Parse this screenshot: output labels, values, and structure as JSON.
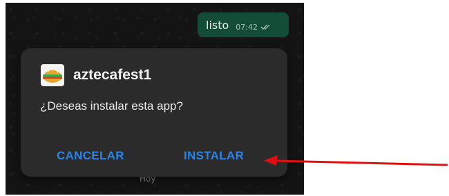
{
  "chat": {
    "message_text": "listo",
    "message_time": "07:42",
    "date_label": "Hoy"
  },
  "dialog": {
    "app_name": "aztecafest1",
    "app_icon": "taco-icon",
    "question": "¿Deseas instalar esta app?",
    "cancel_label": "CANCELAR",
    "install_label": "INSTALAR"
  },
  "colors": {
    "accent": "#2b84ea",
    "dialog_bg": "#2b2b2b",
    "bubble_bg": "#144d37",
    "annotation_arrow": "#e01010"
  }
}
